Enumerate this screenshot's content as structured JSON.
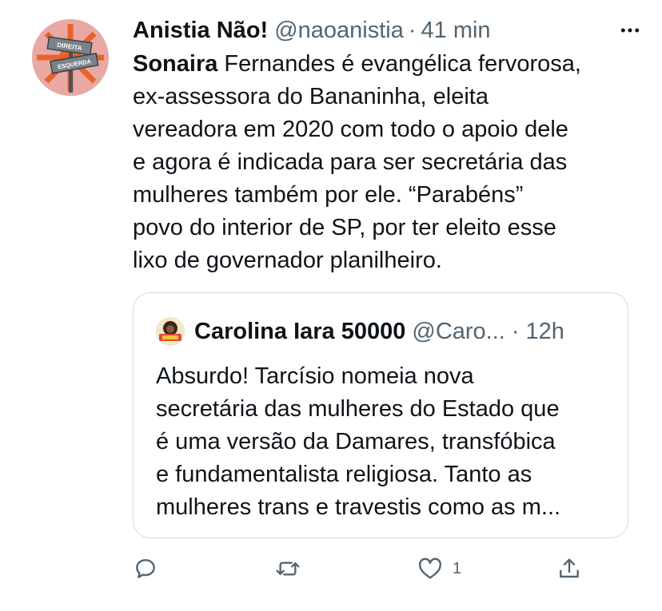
{
  "tweet": {
    "author": {
      "display_name": "Anistia Não!",
      "handle": "@naoanistia",
      "separator": "·",
      "time": "41 min",
      "avatar": {
        "sign_top": "DIREITA",
        "sign_bottom": "ESQUERDA",
        "colors": {
          "background": "#e8a9a4",
          "sunburst": "#e8622c",
          "sign": "#6f7880"
        }
      }
    },
    "more_icon": "more-horizontal-icon",
    "text_first_word": "Sonaira",
    "text_lines": [
      " Fernandes é evangélica fervorosa,",
      "ex-assessora do Bananinha, eleita",
      "vereadora em 2020 com todo o apoio dele",
      "e agora é indicada para ser secretária das",
      "mulheres também por ele. “Parabéns”",
      "povo do interior de SP, por ter eleito esse",
      "lixo de governador planilheiro."
    ],
    "quote": {
      "display_name": "Carolina Iara 50000",
      "handle": "@Caro...",
      "separator": "·",
      "time": "12h",
      "text_lines": [
        "Absurdo! Tarcísio nomeia nova",
        "secretária das mulheres do Estado que",
        "é uma versão da Damares, transfóbica",
        "e fundamentalista religiosa. Tanto as",
        "mulheres trans e travestis como as m..."
      ]
    },
    "actions": {
      "reply": {
        "icon": "reply-icon",
        "count": ""
      },
      "retweet": {
        "icon": "retweet-icon",
        "count": ""
      },
      "like": {
        "icon": "heart-icon",
        "count": "1"
      },
      "share": {
        "icon": "share-icon",
        "count": ""
      }
    },
    "colors": {
      "text": "#0f1419",
      "secondary": "#536471",
      "border": "#cfd9de"
    }
  }
}
